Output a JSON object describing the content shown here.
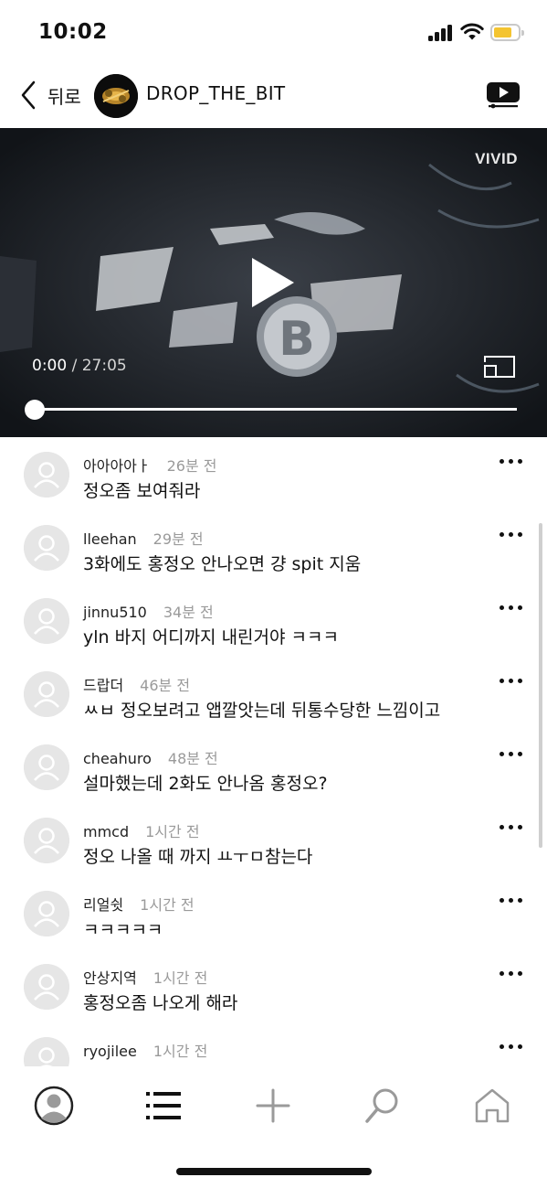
{
  "status_bar": {
    "time": "10:02",
    "icons": [
      "cellular-signal-icon",
      "wifi-icon",
      "battery-icon"
    ],
    "battery_color": "#f4c430"
  },
  "header": {
    "back_label": "뒤로",
    "channel_name": "DROP_THE_BIT",
    "icons": [
      "chevron-left-icon",
      "channel-logo",
      "youtube-play-icon"
    ]
  },
  "player": {
    "watermark": "VIVID",
    "current_time": "0:00",
    "separator": "/",
    "duration": "27:05",
    "progress": 0,
    "icons": [
      "play-icon",
      "fullscreen-icon"
    ]
  },
  "comments": [
    {
      "user": "아아아아ㅏ",
      "ago": "26분 전",
      "text": "정오좀 보여줘라"
    },
    {
      "user": "lleehan",
      "ago": "29분 전",
      "text": "3화에도 홍정오 안나오면 걍 spit 지움"
    },
    {
      "user": "jinnu510",
      "ago": "34분 전",
      "text": "yln 바지 어디까지 내린거야 ㅋㅋㅋ"
    },
    {
      "user": "드랍더",
      "ago": "46분 전",
      "text": "ㅆㅂ 정오보려고 앱깔앗는데 뒤통수당한 느낌이고"
    },
    {
      "user": "cheahuro",
      "ago": "48분 전",
      "text": "설마했는데 2화도 안나옴 홍정오?"
    },
    {
      "user": "mmcd",
      "ago": "1시간 전",
      "text": "정오 나올 때 까지 ㅛㅜㅁ참는다"
    },
    {
      "user": "리얼쉿",
      "ago": "1시간 전",
      "text": "ㅋㅋㅋㅋㅋ"
    },
    {
      "user": "안상지역",
      "ago": "1시간 전",
      "text": "홍정오좀 나오게 해라"
    },
    {
      "user": "ryojilee",
      "ago": "1시간 전",
      "text": ""
    }
  ],
  "bottom_nav": {
    "items": [
      "profile-icon",
      "feed-list-icon",
      "add-icon",
      "search-icon",
      "home-icon"
    ]
  }
}
